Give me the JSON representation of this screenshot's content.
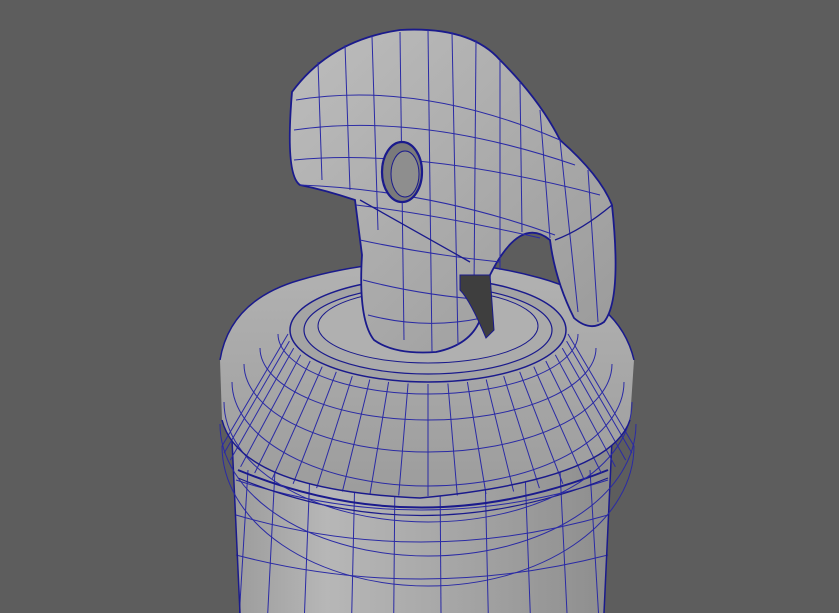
{
  "viewport": {
    "background": "#5d5d5d",
    "surface": "#a9a9a9",
    "surface_light": "#bcbcbc",
    "surface_dark": "#8e8e8e",
    "wire": "#1a1a8c",
    "wire_secondary": "#2a2aa5"
  },
  "scene": {
    "object": "spray-bottle-trigger-mesh",
    "shading": "wireframe-on-shaded"
  }
}
